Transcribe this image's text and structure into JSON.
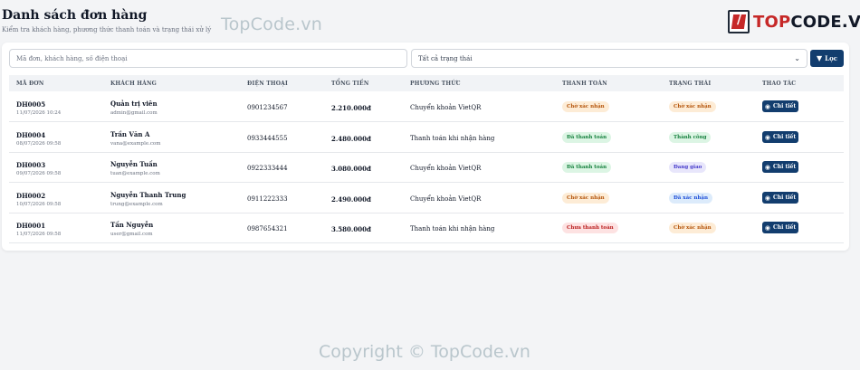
{
  "header": {
    "title": "Danh sách đơn hàng",
    "subtitle": "Kiểm tra khách hàng, phương thức thanh toán và trạng thái xử lý"
  },
  "watermark": {
    "top": "TopCode.vn",
    "bottom": "Copyright © TopCode.vn"
  },
  "logo": {
    "prefix": "TOP",
    "suffix": "CODE.VN"
  },
  "filters": {
    "search_placeholder": "Mã đơn, khách hàng, số điện thoại",
    "status_selected": "Tất cả trạng thái",
    "filter_label": "Lọc",
    "filter_icon": "filter-icon",
    "chevron_icon": "chevron-down-icon"
  },
  "table": {
    "headers": [
      "MÃ ĐƠN",
      "KHÁCH HÀNG",
      "ĐIỆN THOẠI",
      "TỔNG TIỀN",
      "PHƯƠNG THỨC",
      "THANH TOÁN",
      "TRẠNG THÁI",
      "THAO TÁC"
    ],
    "detail_label": "Chi tiết",
    "detail_icon": "eye-icon",
    "rows": [
      {
        "code": "DH0005",
        "date": "11/07/2026 10:24",
        "name": "Quản trị viên",
        "email": "admin@gmail.com",
        "phone": "0901234567",
        "total": "2.210.000đ",
        "method": "Chuyển khoản VietQR",
        "payment": "Chờ xác nhận",
        "payment_bg": "#fdecd6",
        "payment_fg": "#b45309",
        "status": "Chờ xác nhận",
        "status_bg": "#fdecd6",
        "status_fg": "#b45309"
      },
      {
        "code": "DH0004",
        "date": "08/07/2026 09:58",
        "name": "Trần Văn A",
        "email": "vana@example.com",
        "phone": "0933444555",
        "total": "2.480.000đ",
        "method": "Thanh toán khi nhận hàng",
        "payment": "Đã thanh toán",
        "payment_bg": "#dcf5e4",
        "payment_fg": "#15803d",
        "status": "Thành công",
        "status_bg": "#dcf5e4",
        "status_fg": "#15803d"
      },
      {
        "code": "DH0003",
        "date": "09/07/2026 09:58",
        "name": "Nguyễn Tuấn",
        "email": "tuan@example.com",
        "phone": "0922333444",
        "total": "3.080.000đ",
        "method": "Chuyển khoản VietQR",
        "payment": "Đã thanh toán",
        "payment_bg": "#dcf5e4",
        "payment_fg": "#15803d",
        "status": "Đang giao",
        "status_bg": "#e8e6fb",
        "status_fg": "#4338ca"
      },
      {
        "code": "DH0002",
        "date": "10/07/2026 09:58",
        "name": "Nguyễn Thanh Trung",
        "email": "trung@example.com",
        "phone": "0911222333",
        "total": "2.490.000đ",
        "method": "Chuyển khoản VietQR",
        "payment": "Chờ xác nhận",
        "payment_bg": "#fdecd6",
        "payment_fg": "#b45309",
        "status": "Đã xác nhận",
        "status_bg": "#dcebfb",
        "status_fg": "#1d4ed8"
      },
      {
        "code": "DH0001",
        "date": "11/07/2026 09:58",
        "name": "Tấn Nguyễn",
        "email": "user@gmail.com",
        "phone": "0987654321",
        "total": "3.580.000đ",
        "method": "Thanh toán khi nhận hàng",
        "payment": "Chưa thanh toán",
        "payment_bg": "#fde2e2",
        "payment_fg": "#b91c1c",
        "status": "Chờ xác nhận",
        "status_bg": "#fdecd6",
        "status_fg": "#b45309"
      }
    ]
  }
}
